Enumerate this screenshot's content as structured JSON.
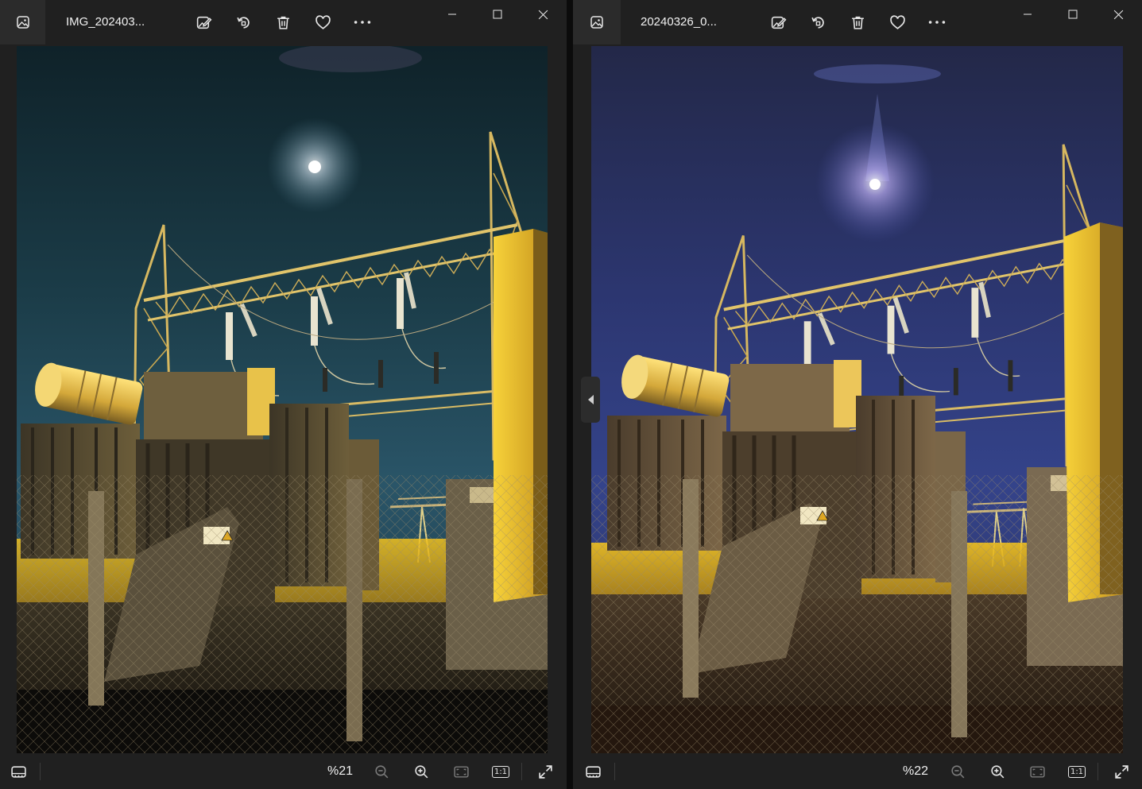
{
  "left_window": {
    "title": "IMG_202403...",
    "zoom": "%21",
    "toolbar_icons": [
      "edit-image-icon",
      "rotate-icon",
      "delete-icon",
      "favorite-icon",
      "more-icon"
    ],
    "bottom_icons": [
      "filmstrip-icon",
      "zoom-out-icon",
      "zoom-in-icon",
      "fit-to-window-icon",
      "actual-size-icon",
      "fullscreen-icon"
    ],
    "actual_size_label": "1:1"
  },
  "right_window": {
    "title": "20240326_0...",
    "zoom": "%22",
    "toolbar_icons": [
      "edit-image-icon",
      "rotate-icon",
      "delete-icon",
      "favorite-icon",
      "more-icon"
    ],
    "bottom_icons": [
      "filmstrip-icon",
      "zoom-out-icon",
      "zoom-in-icon",
      "fit-to-window-icon",
      "actual-size-icon",
      "fullscreen-icon"
    ],
    "actual_size_label": "1:1"
  },
  "colors": {
    "chrome_bg": "#202020",
    "icon": "#e6e6e6",
    "disabled_icon": "#7a7a7a",
    "left_sky": "#1d4250",
    "right_sky": "#2b3570",
    "sodium_light": "#f0c020"
  }
}
